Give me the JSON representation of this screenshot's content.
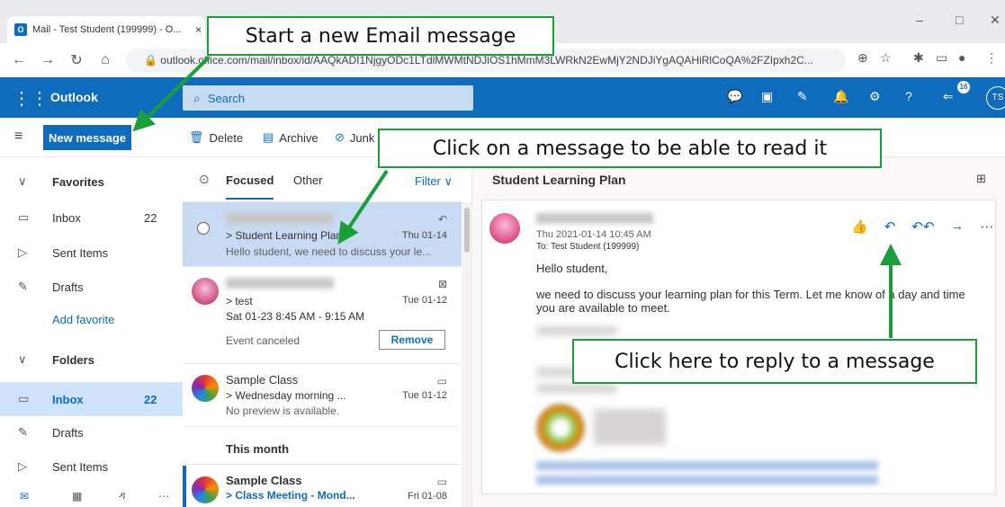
{
  "browser": {
    "tab_title": "Mail - Test Student (199999) - O...",
    "tab_close": "×",
    "url": "outlook.office.com/mail/inbox/id/AAQkADI1NjgyODc1LTdlMWMtNDJiOS1hMmM3LWRkN2EwMjY2NDJiYgAQAHiRlCoQA%2FZIpxh2C...",
    "top_note": "Start a new Email message",
    "win_min": "–",
    "win_max": "□",
    "win_close": "✕"
  },
  "suite": {
    "app_name": "Outlook",
    "search_placeholder": "Search",
    "notif_count": "16",
    "user_initials": "TS"
  },
  "toolbar": {
    "new_message": "New message",
    "delete": "Delete",
    "archive": "Archive",
    "junk": "Junk"
  },
  "nav": {
    "favorites": "Favorites",
    "inbox_fav": "Inbox",
    "inbox_fav_count": "22",
    "sent_fav": "Sent Items",
    "drafts_fav": "Drafts",
    "add_favorite": "Add favorite",
    "folders": "Folders",
    "inbox": "Inbox",
    "inbox_count": "22",
    "drafts": "Drafts",
    "sent": "Sent Items"
  },
  "list": {
    "tab_focused": "Focused",
    "tab_other": "Other",
    "filter": "Filter",
    "section_month": "This month",
    "messages": [
      {
        "subject": "> Student Learning Plan",
        "date": "Thu 01-14",
        "preview": "Hello student, we need to discuss your le..."
      },
      {
        "subject": "> test",
        "date": "Tue 01-12",
        "when": "Sat 01-23 8:45 AM - 9:15 AM",
        "status": "Event canceled",
        "action": "Remove"
      },
      {
        "sender": "Sample Class",
        "subject": "> Wednesday morning ...",
        "date": "Tue 01-12",
        "preview": "No preview is available."
      },
      {
        "sender": "Sample Class",
        "subject": "> Class Meeting - Mond...",
        "date": "Fri 01-08"
      }
    ]
  },
  "reading": {
    "title": "Student Learning Plan",
    "date": "Thu 2021-01-14 10:45 AM",
    "to": "To:  Test Student (199999)",
    "greeting": "Hello student,",
    "body": "we need to discuss your learning plan for this Term. Let me know of a day and time you are available to meet."
  },
  "annotations": {
    "new_email": "Start a new Email message",
    "read_msg": "Click on a message to be able to read it",
    "reply": "Click here to reply to a message"
  },
  "colors": {
    "accent": "#0f6cbd",
    "callout_border": "#1a9e3a"
  }
}
